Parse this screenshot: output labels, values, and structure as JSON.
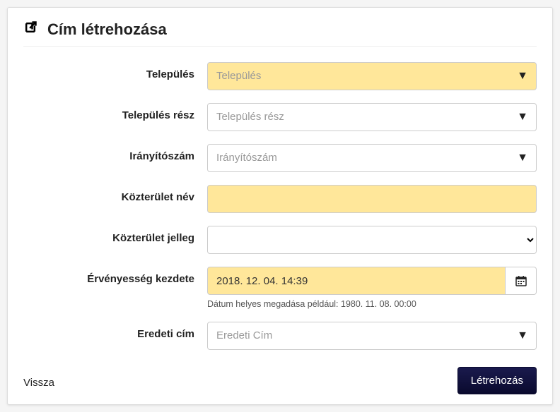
{
  "header": {
    "title": "Cím létrehozása"
  },
  "fields": {
    "telepules": {
      "label": "Település",
      "placeholder": "Település"
    },
    "telepules_resz": {
      "label": "Település rész",
      "placeholder": "Település rész"
    },
    "iranyitoszam": {
      "label": "Irányítószám",
      "placeholder": "Irányítószám"
    },
    "kozterulet_nev": {
      "label": "Közterület név",
      "value": ""
    },
    "kozterulet_jelleg": {
      "label": "Közterület jelleg",
      "value": ""
    },
    "ervenyesseg": {
      "label": "Érvényesség kezdete",
      "value": "2018. 12. 04. 14:39",
      "hint": "Dátum helyes megadása például: 1980. 11. 08. 00:00"
    },
    "eredeti_cim": {
      "label": "Eredeti cím",
      "placeholder": "Eredeti Cím"
    }
  },
  "buttons": {
    "submit": "Létrehozás",
    "back": "Vissza"
  }
}
